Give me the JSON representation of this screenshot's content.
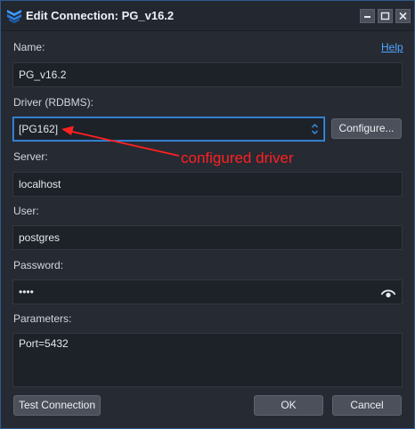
{
  "window": {
    "title": "Edit Connection: PG_v16.2",
    "minimize_symbol": "minimize-icon",
    "maximize_symbol": "maximize-icon",
    "close_symbol": "close-icon"
  },
  "form": {
    "name_label": "Name:",
    "help_link": "Help",
    "name_value": "PG_v16.2",
    "driver_label": "Driver (RDBMS):",
    "driver_value": "[PG162]",
    "configure_button": "Configure...",
    "server_label": "Server:",
    "server_value": "localhost",
    "user_label": "User:",
    "user_value": "postgres",
    "password_label": "Password:",
    "password_value": "••••",
    "parameters_label": "Parameters:",
    "parameters_value": "Port=5432"
  },
  "annotation": {
    "text": "configured driver",
    "color": "#ff2020"
  },
  "buttons": {
    "test_connection": "Test Connection",
    "ok": "OK",
    "cancel": "Cancel"
  },
  "colors": {
    "accent": "#3a8fe8",
    "link": "#4ea6ff"
  }
}
